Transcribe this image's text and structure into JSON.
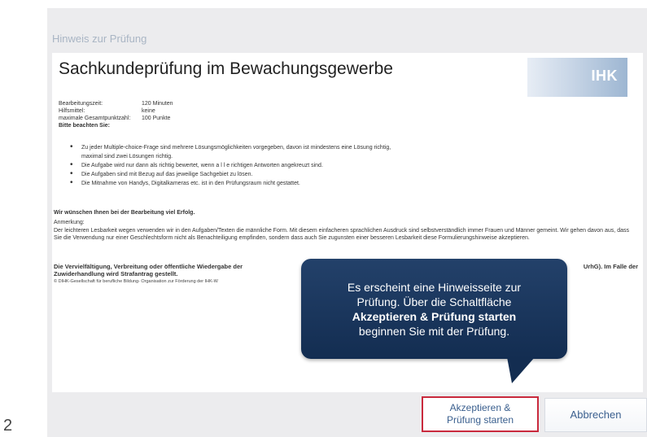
{
  "dialog": {
    "title": "Hinweis zur Prüfung"
  },
  "document": {
    "heading": "Sachkundeprüfung im Bewachungsgewerbe",
    "logo_text": "IHK",
    "info": [
      {
        "label": "Bearbeitungszeit:",
        "value": "120 Minuten"
      },
      {
        "label": "Hilfsmittel:",
        "value": "keine"
      },
      {
        "label": "maximale Gesamtpunktzahl:",
        "value": "100 Punkte"
      }
    ],
    "attention": "Bitte beachten Sie:",
    "bullets": [
      "Zu jeder Multiple-choice-Frage sind mehrere Lösungsmöglichkeiten vorgegeben, davon ist mindestens eine Lösung richtig,",
      "maximal sind zwei Lösungen richtig.",
      "Die Aufgabe wird nur dann als richtig bewertet, wenn a l l e richtigen Antworten angekreuzt sind.",
      "Die Aufgaben sind mit Bezug auf das jeweilige Sachgebiet zu lösen.",
      "Die Mitnahme von Handys, Digitalkameras etc. ist in den Prüfungsraum nicht gestattet."
    ],
    "wish": "Wir wünschen Ihnen bei der Bearbeitung viel Erfolg.",
    "note_label": "Anmerkung:",
    "note_text": "Der leichteren Lesbarkeit wegen verwenden wir in den Aufgaben/Texten die männliche Form. Mit diesem einfacheren sprachlichen Ausdruck sind selbstverständlich immer Frauen und Männer gemeint. Wir gehen davon aus, dass Sie die Verwendung nur einer Geschlechtsform nicht als Benachteiligung empfinden, sondern dass auch Sie zugunsten einer besseren Lesbarkeit diese Formulierungshinweise akzeptieren.",
    "copyright_left": "Die Vervielfältigung, Verbreitung oder öffentliche Wiedergabe der",
    "copyright_right": "UrhG). Im Falle der",
    "copyright_line2": "Zuwiderhandlung wird Strafantrag gestellt.",
    "copyright_small": "© DIHK-Gesellschaft für berufliche Bildung- Organisation zur Förderung der IHK-W"
  },
  "callout": {
    "line1": "Es erscheint eine Hinweisseite zur",
    "line2": "Prüfung. Über die Schaltfläche",
    "line3_bold": "Akzeptieren & Prüfung starten",
    "line4": "beginnen Sie mit der Prüfung."
  },
  "buttons": {
    "accept_line1": "Akzeptieren &",
    "accept_line2": "Prüfung starten",
    "cancel": "Abbrechen"
  },
  "step_number": "2"
}
